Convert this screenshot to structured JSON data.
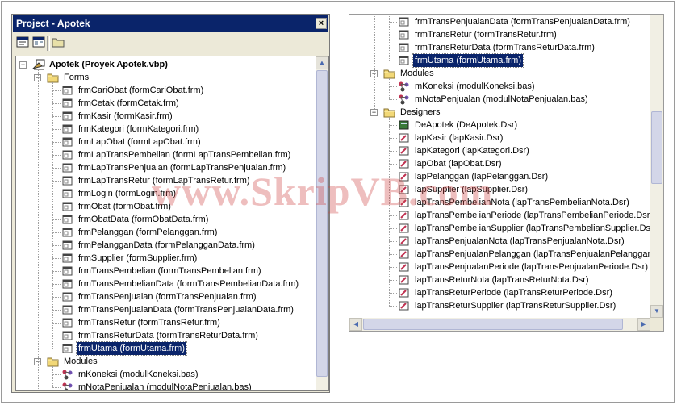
{
  "window": {
    "title": "Project - Apotek",
    "close_glyph": "×"
  },
  "toolbar": {
    "buttons": [
      {
        "name": "view-code-button",
        "icon": "view-code-icon"
      },
      {
        "name": "view-object-button",
        "icon": "view-object-icon"
      },
      {
        "name": "toggle-folders-button",
        "icon": "folder-icon"
      }
    ]
  },
  "left_tree": {
    "project": "Apotek (Proyek Apotek.vbp)",
    "forms_folder": "Forms",
    "forms": [
      "frmCariObat (formCariObat.frm)",
      "frmCetak (formCetak.frm)",
      "frmKasir (formKasir.frm)",
      "frmKategori (formKategori.frm)",
      "frmLapObat (formLapObat.frm)",
      "frmLapTransPembelian (formLapTransPembelian.frm)",
      "frmLapTransPenjualan (formLapTransPenjualan.frm)",
      "frmLapTransRetur (formLapTransRetur.frm)",
      "frmLogin (formLogin.frm)",
      "frmObat (formObat.frm)",
      "frmObatData (formObatData.frm)",
      "frmPelanggan (formPelanggan.frm)",
      "frmPelangganData (formPelangganData.frm)",
      "frmSupplier (formSupplier.frm)",
      "frmTransPembelian (formTransPembelian.frm)",
      "frmTransPembelianData (formTransPembelianData.frm)",
      "frmTransPenjualan (formTransPenjualan.frm)",
      "frmTransPenjualanData (formTransPenjualanData.frm)",
      "frmTransRetur (formTransRetur.frm)",
      "frmTransReturData (formTransReturData.frm)",
      "frmUtama (formUtama.frm)"
    ],
    "selected_form": "frmUtama (formUtama.frm)",
    "modules_folder": "Modules",
    "modules": [
      "mKoneksi (modulKoneksi.bas)",
      "mNotaPenjualan (modulNotaPenjualan.bas)"
    ]
  },
  "right_tree": {
    "forms_tail": [
      "frmTransPenjualanData (formTransPenjualanData.frm)",
      "frmTransRetur (formTransRetur.frm)",
      "frmTransReturData (formTransReturData.frm)",
      "frmUtama (formUtama.frm)"
    ],
    "modules_folder": "Modules",
    "modules": [
      "mKoneksi (modulKoneksi.bas)",
      "mNotaPenjualan (modulNotaPenjualan.bas)"
    ],
    "designers_folder": "Designers",
    "designers": [
      "DeApotek (DeApotek.Dsr)",
      "lapKasir (lapKasir.Dsr)",
      "lapKategori (lapKategori.Dsr)",
      "lapObat (lapObat.Dsr)",
      "lapPelanggan (lapPelanggan.Dsr)",
      "lapSupplier (lapSupplier.Dsr)",
      "lapTransPembelianNota (lapTransPembelianNota.Dsr)",
      "lapTransPembelianPeriode (lapTransPembelianPeriode.Dsr)",
      "lapTransPembelianSupplier (lapTransPembelianSupplier.Dsr)",
      "lapTransPenjualanNota (lapTransPenjualanNota.Dsr)",
      "lapTransPenjualanPelanggan (lapTransPenjualanPelanggan.D",
      "lapTransPenjualanPeriode (lapTransPenjualanPeriode.Dsr)",
      "lapTransReturNota (lapTransReturNota.Dsr)",
      "lapTransReturPeriode (lapTransReturPeriode.Dsr)",
      "lapTransReturSupplier (lapTransReturSupplier.Dsr)"
    ]
  },
  "watermark": "www.SkripVB.com",
  "colors": {
    "titlebar": "#0a246a",
    "selection": "#0a246a",
    "folder": "#e8c860"
  }
}
